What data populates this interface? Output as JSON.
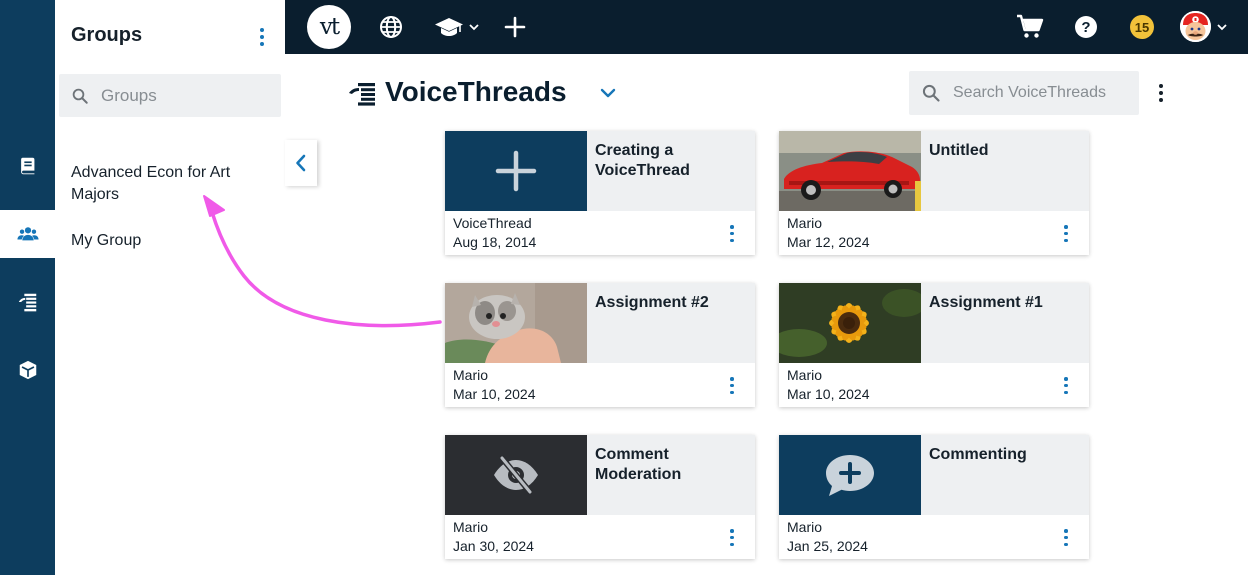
{
  "rail": {
    "items": [
      {
        "name": "book-icon",
        "active": false
      },
      {
        "name": "groups-icon",
        "active": true
      },
      {
        "name": "voicethreads-icon",
        "active": false
      },
      {
        "name": "cube-icon",
        "active": false
      }
    ]
  },
  "groups_panel": {
    "title": "Groups",
    "search_placeholder": "Groups",
    "items": [
      {
        "label": "Advanced Econ for Art Majors"
      },
      {
        "label": "My Group"
      }
    ]
  },
  "topbar": {
    "logo_text": "vt",
    "badge_count": "15",
    "icons": [
      "globe-icon",
      "graduation-cap-icon",
      "chevron-down-icon",
      "plus-icon",
      "cart-icon",
      "help-icon",
      "avatar",
      "chevron-down-icon"
    ]
  },
  "main": {
    "title": "VoiceThreads",
    "search_placeholder": "Search VoiceThreads",
    "cards": [
      {
        "title": "Creating a VoiceThread",
        "owner": "VoiceThread",
        "date": "Aug 18, 2014",
        "thumb": "plus-icon"
      },
      {
        "title": "Untitled",
        "owner": "Mario",
        "date": "Mar 12, 2024",
        "thumb": "red-car-photo"
      },
      {
        "title": "Assignment #2",
        "owner": "Mario",
        "date": "Mar 10, 2024",
        "thumb": "kitten-photo"
      },
      {
        "title": "Assignment #1",
        "owner": "Mario",
        "date": "Mar 10, 2024",
        "thumb": "sunflower-photo"
      },
      {
        "title": "Comment Moderation",
        "owner": "Mario",
        "date": "Jan 30, 2024",
        "thumb": "eye-slash-icon"
      },
      {
        "title": "Commenting",
        "owner": "Mario",
        "date": "Jan 25, 2024",
        "thumb": "comment-plus-icon"
      }
    ]
  },
  "colors": {
    "rail_bg": "#0d3d5e",
    "topbar_bg": "#0a1e2e",
    "accent": "#1676b8",
    "card_tile_blue": "#0d3d5e",
    "card_tile_dark": "#2b2d31",
    "annotation_arrow": "#f05ae8",
    "badge": "#f2c23a"
  }
}
